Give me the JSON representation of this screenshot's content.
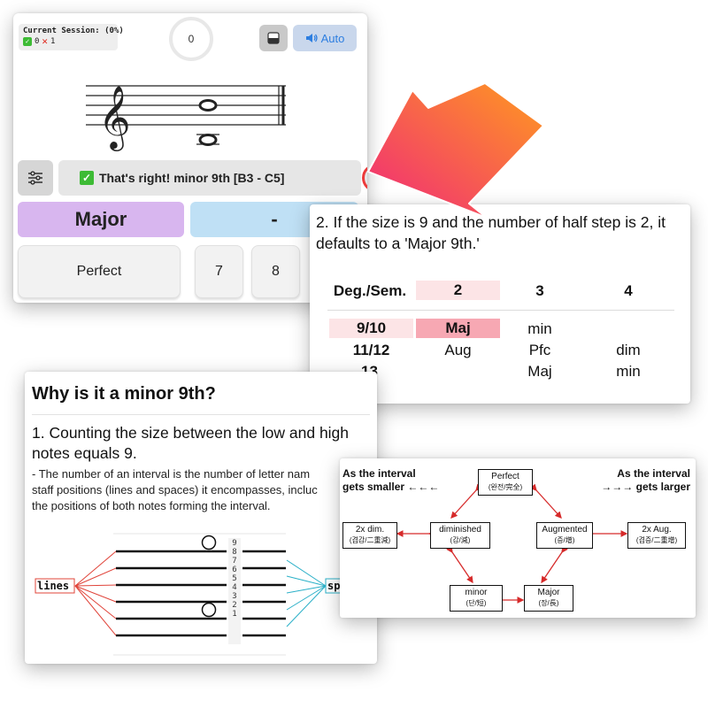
{
  "app": {
    "session_title": "Current Session: (0%)",
    "correct_count": "0",
    "wrong_count": "1",
    "counter": "0",
    "auto_label": "Auto",
    "feedback": "That's right! minor 9th [B3 - C5]",
    "buttons": {
      "quality_selected": "Major",
      "quality_other": "-",
      "perfect": "Perfect",
      "numbers": [
        "7",
        "8"
      ]
    },
    "colors": {
      "major_button": "#d8b6ef",
      "dash_button": "#bfe0f5",
      "auto_text": "#2d7ee0",
      "highlight_ring": "#ec3a3a"
    }
  },
  "arrow": {
    "color_start": "#ff9a1f",
    "color_end": "#f0287a"
  },
  "rule": {
    "text": "2. If the size is 9 and the number of half step is 2, it defaults to a 'Major 9th.'",
    "header": [
      "Deg./Sem.",
      "2",
      "3",
      "4"
    ],
    "rows": [
      [
        "9/10",
        "Maj",
        "min",
        ""
      ],
      [
        "11/12",
        "Aug",
        "Pfc",
        "dim"
      ],
      [
        "13",
        "",
        "Maj",
        "min"
      ]
    ]
  },
  "why": {
    "title": "Why is it a minor 9th?",
    "step": "1. Counting the size between the low and high notes equals 9.",
    "detail": "  - The number of an interval is the number of letter nam\nstaff positions (lines and spaces) it encompasses, incluc\nthe positions of both notes forming the interval.",
    "numbers": [
      "9",
      "8",
      "7",
      "6",
      "5",
      "4",
      "3",
      "2",
      "1"
    ],
    "lines_label": "lines",
    "spaces_label": "sp"
  },
  "diagram": {
    "left_label": [
      "As the interval",
      "gets smaller ←←←"
    ],
    "right_label": [
      "As the interval",
      "→→→ gets larger"
    ],
    "nodes": {
      "perfect": {
        "name": "Perfect",
        "sub": "(완전/完全)"
      },
      "dim2": {
        "name": "2x dim.",
        "sub": "(겹감/二重減)"
      },
      "diminished": {
        "name": "diminished",
        "sub": "(감/減)"
      },
      "augmented": {
        "name": "Augmented",
        "sub": "(증/增)"
      },
      "aug2": {
        "name": "2x Aug.",
        "sub": "(겹증/二重增)"
      },
      "minor": {
        "name": "minor",
        "sub": "(단/短)"
      },
      "major": {
        "name": "Major",
        "sub": "(장/長)"
      }
    },
    "arrow_color": "#d62a2a"
  }
}
